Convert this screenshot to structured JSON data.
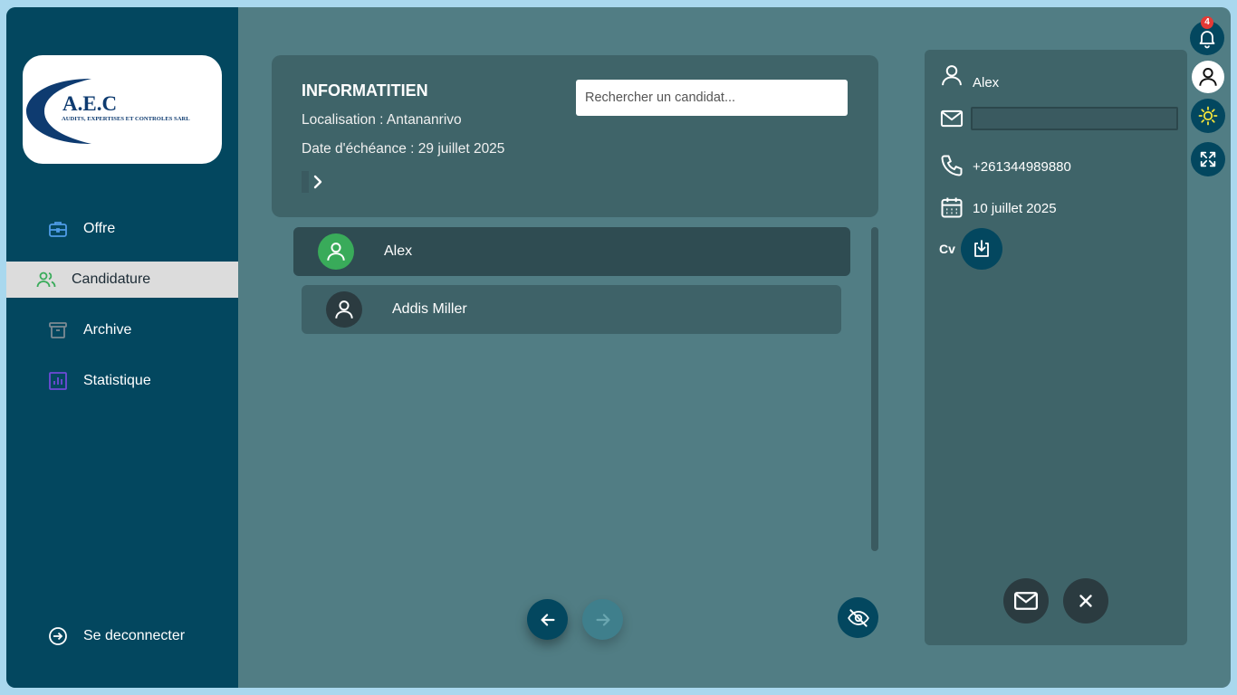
{
  "sidebar": {
    "logo": {
      "brand": "A.E.C",
      "tagline": "AUDITS, EXPERTISES ET CONTROLES SARL"
    },
    "items": [
      {
        "label": "Offre",
        "icon": "briefcase-icon",
        "color": "#4f9ce8"
      },
      {
        "label": "Candidature",
        "icon": "users-icon",
        "color": "#39ab5a",
        "active": true
      },
      {
        "label": "Archive",
        "icon": "archive-icon",
        "color": "#7d8a93"
      },
      {
        "label": "Statistique",
        "icon": "chart-icon",
        "color": "#6f4bd8"
      }
    ],
    "logout": {
      "label": "Se deconnecter",
      "icon": "logout-icon"
    }
  },
  "job": {
    "title": "INFORMATITIEN",
    "location": "Localisation : Antananrivo",
    "deadline": "Date d'échéance : 29 juillet 2025"
  },
  "search": {
    "placeholder": "Rechercher un candidat..."
  },
  "candidates": [
    {
      "name": "Alex",
      "avatar_color": "#39ab5a",
      "selected": true
    },
    {
      "name": "Addis Miller",
      "avatar_color": "#2b3b40"
    }
  ],
  "detail": {
    "name": "Alex",
    "email": "",
    "phone": "+261344989880",
    "date": "10 juillet 2025",
    "cv_label": "Cv"
  },
  "topbar": {
    "notification_count": "4"
  },
  "colors": {
    "sidebar": "#03475f",
    "main_bg": "#517d84",
    "card": "#3f6469",
    "sun_icon": "#f2e33a"
  }
}
